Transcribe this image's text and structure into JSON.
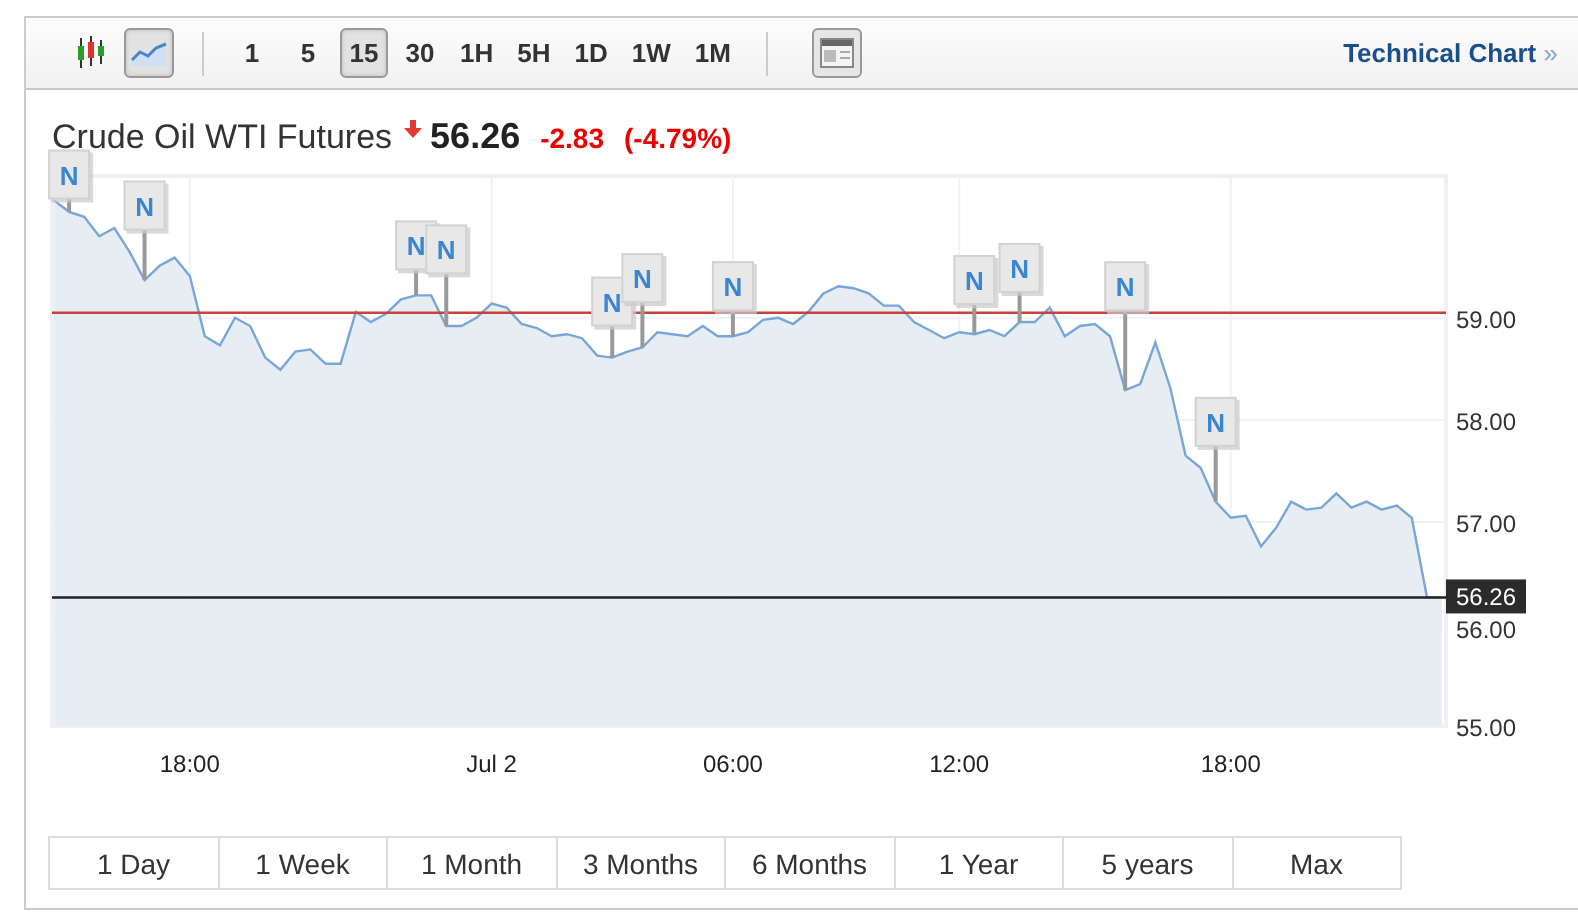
{
  "toolbar": {
    "chart_types": [
      {
        "kind": "candlestick",
        "selected": false
      },
      {
        "kind": "line",
        "selected": true
      }
    ],
    "intervals": [
      {
        "label": "1",
        "selected": false
      },
      {
        "label": "5",
        "selected": false
      },
      {
        "label": "15",
        "selected": true
      },
      {
        "label": "30",
        "selected": false
      },
      {
        "label": "1H",
        "selected": false
      },
      {
        "label": "5H",
        "selected": false
      },
      {
        "label": "1D",
        "selected": false
      },
      {
        "label": "1W",
        "selected": false
      },
      {
        "label": "1M",
        "selected": false
      }
    ],
    "link": {
      "label": "Technical Chart",
      "arrow": "»"
    }
  },
  "quote": {
    "name": "Crude Oil WTI Futures",
    "price": "56.26",
    "change": "-2.83",
    "change_percent": "(-4.79%)"
  },
  "chart": {
    "last_price_label": "56.26",
    "chart_data": {
      "type": "area",
      "categories": [
        null,
        null,
        null,
        null,
        null,
        null,
        null,
        null,
        null,
        "18:00",
        null,
        null,
        null,
        null,
        null,
        null,
        null,
        null,
        null,
        null,
        null,
        null,
        null,
        null,
        null,
        null,
        null,
        null,
        null,
        "Jul 2",
        null,
        null,
        null,
        null,
        null,
        null,
        null,
        null,
        null,
        null,
        null,
        null,
        null,
        null,
        null,
        "06:00",
        null,
        null,
        null,
        null,
        null,
        null,
        null,
        null,
        null,
        null,
        null,
        null,
        null,
        null,
        "12:00",
        null,
        null,
        null,
        null,
        null,
        null,
        null,
        null,
        null,
        null,
        null,
        null,
        null,
        null,
        null,
        null,
        null,
        "18:00",
        null,
        null,
        null,
        null,
        null,
        null,
        null,
        null,
        null,
        null,
        null,
        null,
        null,
        null
      ],
      "series": [
        {
          "color": "#78a6d8",
          "values": [
            60.15,
            60.04,
            59.99,
            59.8,
            59.88,
            59.65,
            59.37,
            59.51,
            59.59,
            59.41,
            58.82,
            58.73,
            59.0,
            58.92,
            58.61,
            58.49,
            58.67,
            58.69,
            58.55,
            58.55,
            59.06,
            58.96,
            59.04,
            59.18,
            59.22,
            59.22,
            58.92,
            58.92,
            59.0,
            59.14,
            59.1,
            58.94,
            58.9,
            58.82,
            58.84,
            58.8,
            58.63,
            58.61,
            58.67,
            58.71,
            58.86,
            58.84,
            58.82,
            58.92,
            58.82,
            58.82,
            58.86,
            58.98,
            59.0,
            58.94,
            59.06,
            59.24,
            59.31,
            59.29,
            59.24,
            59.12,
            59.12,
            58.96,
            58.88,
            58.8,
            58.86,
            58.84,
            58.88,
            58.82,
            58.96,
            58.96,
            59.1,
            58.82,
            58.92,
            58.94,
            58.82,
            58.29,
            58.35,
            58.76,
            58.31,
            57.65,
            57.53,
            57.2,
            57.04,
            57.06,
            56.76,
            56.94,
            57.2,
            57.12,
            57.14,
            57.28,
            57.14,
            57.2,
            57.12,
            57.16,
            57.04,
            56.26,
            56.26
          ]
        }
      ],
      "ylim": [
        55,
        60.39
      ],
      "yticks": [
        {
          "value": 55,
          "label": "55.00"
        },
        {
          "value": 56,
          "label": "56.00"
        },
        {
          "value": 57,
          "label": "57.00"
        },
        {
          "value": 58,
          "label": "58.00"
        },
        {
          "value": 59,
          "label": "59.00"
        }
      ],
      "grid": true,
      "ref_lines": [
        {
          "axis": "y",
          "value": 59.05,
          "color": "#c9413a"
        },
        {
          "axis": "y",
          "value": 56.26,
          "color": "#222222"
        }
      ]
    },
    "news_flags": [
      {
        "text": "N"
      },
      {
        "text": "N"
      },
      {
        "text": "N"
      },
      {
        "text": "N"
      },
      {
        "text": "N"
      },
      {
        "text": "N"
      },
      {
        "text": "N"
      },
      {
        "text": "N"
      },
      {
        "text": "N"
      },
      {
        "text": "N"
      },
      {
        "text": "N"
      }
    ]
  },
  "ranges": [
    {
      "label": "1 Day",
      "selected": false
    },
    {
      "label": "1 Week",
      "selected": false
    },
    {
      "label": "1 Month",
      "selected": false
    },
    {
      "label": "3 Months",
      "selected": false
    },
    {
      "label": "6 Months",
      "selected": false
    },
    {
      "label": "1 Year",
      "selected": false
    },
    {
      "label": "5 years",
      "selected": false
    },
    {
      "label": "Max",
      "selected": false
    }
  ]
}
